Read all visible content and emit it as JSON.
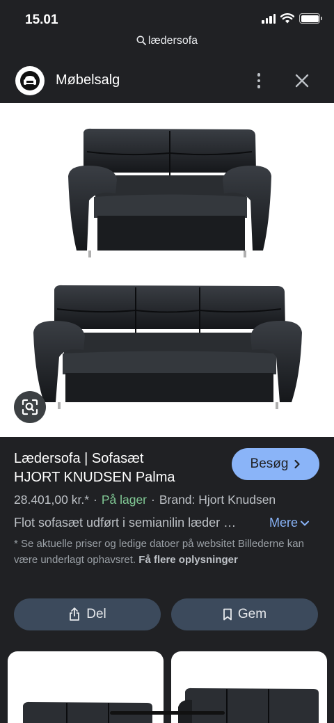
{
  "status_bar": {
    "time": "15.01",
    "battery_icon": "battery-icon",
    "wifi_icon": "wifi-icon",
    "signal_icon": "cellular-signal-icon"
  },
  "search": {
    "query": "lædersofa",
    "icon": "search-icon"
  },
  "site": {
    "name": "Møbelsalg",
    "logo_icon": "armchair-logo-icon"
  },
  "product": {
    "title_line1": "Lædersofa | Sofasæt",
    "title_line2": "HJORT KNUDSEN Palma",
    "visit_label": "Besøg",
    "price": "28.401,00 kr.*",
    "stock": "På lager",
    "brand": "Brand: Hjort Knudsen",
    "description": "Flot sofasæt udført i semianilin læder …",
    "more_label": "Mere",
    "disclaimer_text": "* Se aktuelle priser og ledige datoer på websitet Billederne kan være underlagt ophavsret.",
    "disclaimer_link": "Få flere oplysninger"
  },
  "actions": {
    "share_label": "Del",
    "save_label": "Gem"
  },
  "colors": {
    "accent": "#8ab4f8",
    "stock_green": "#81c995",
    "background": "#202124",
    "button_bg": "#3c4a5c",
    "sofa": "#1e2124"
  }
}
